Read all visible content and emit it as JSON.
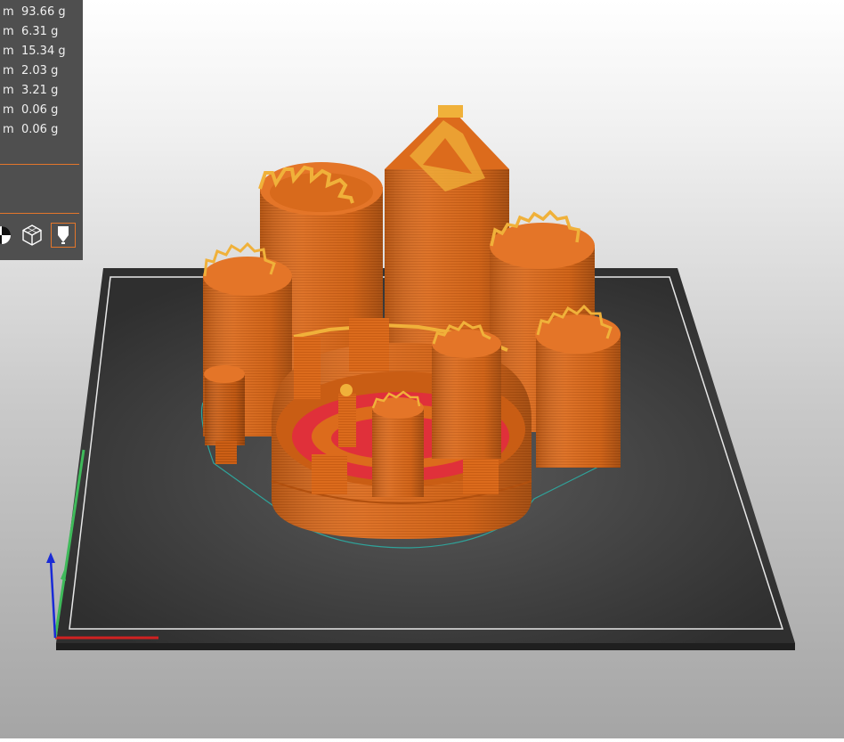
{
  "stats_panel": {
    "rows": [
      {
        "unit": "m",
        "weight": "93.66 g"
      },
      {
        "unit": "m",
        "weight": "6.31 g"
      },
      {
        "unit": "m",
        "weight": "15.34 g"
      },
      {
        "unit": "m",
        "weight": "2.03 g"
      },
      {
        "unit": "m",
        "weight": "3.21 g"
      },
      {
        "unit": "m",
        "weight": "0.06 g"
      },
      {
        "unit": "m",
        "weight": "0.06 g"
      }
    ],
    "toolbar_icons": [
      "half-circle-icon",
      "wireframe-cube-icon",
      "nozzle-icon"
    ]
  },
  "colors": {
    "panel_bg": "#4f4f4f",
    "accent": "#e4762b",
    "bed": "#353535",
    "model": "#dc6b1c",
    "model_highlight": "#f0b13a",
    "solid_infill": "#e0303a",
    "skirt": "#2fa39a",
    "axis_x": "#d12121",
    "axis_y": "#3fba5a",
    "axis_z": "#1a2bd6"
  }
}
